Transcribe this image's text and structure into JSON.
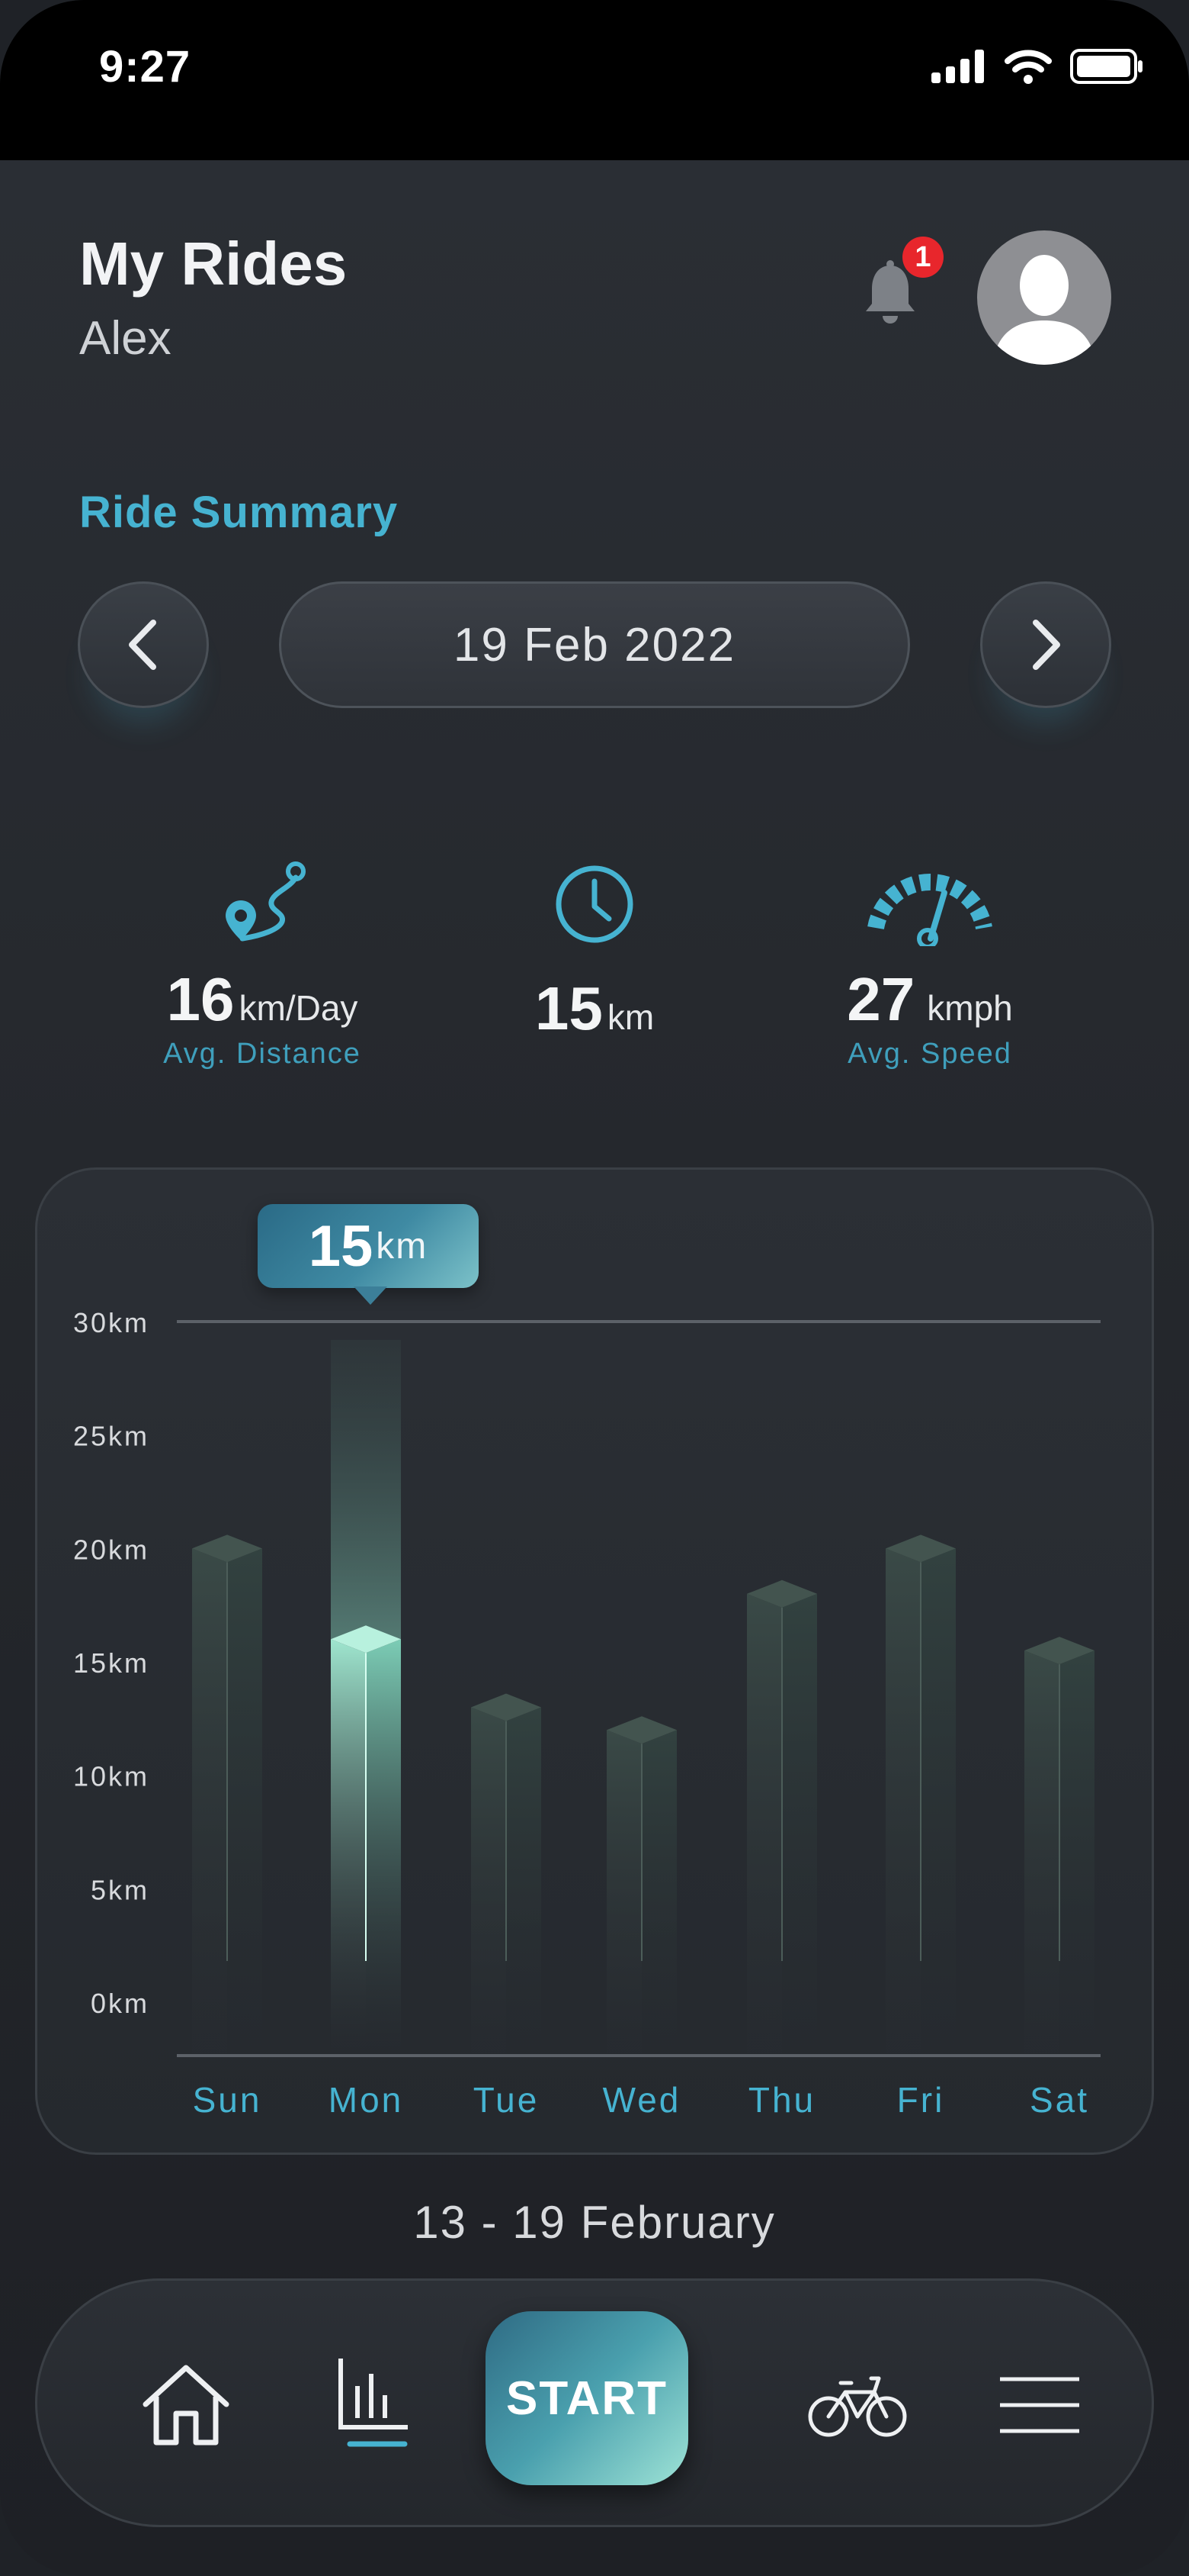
{
  "status_bar": {
    "time": "9:27"
  },
  "header": {
    "title": "My Rides",
    "user": "Alex",
    "notification_count": "1"
  },
  "summary": {
    "label": "Ride Summary",
    "date": "19 Feb 2022"
  },
  "stats": {
    "distance": {
      "value": "16",
      "unit": "km/Day",
      "caption": "Avg. Distance",
      "icon": "route-pin-icon"
    },
    "time": {
      "value": "15",
      "unit": "km",
      "icon": "clock-icon"
    },
    "speed": {
      "value": "27",
      "unit": "kmph",
      "caption": "Avg. Speed",
      "icon": "speedometer-icon"
    }
  },
  "tooltip": {
    "value": "15",
    "unit": "km"
  },
  "chart_data": {
    "type": "bar",
    "categories": [
      "Sun",
      "Mon",
      "Tue",
      "Wed",
      "Thu",
      "Fri",
      "Sat"
    ],
    "values": [
      20,
      16,
      13,
      12,
      18,
      20,
      15.5
    ],
    "highlighted": "Mon",
    "y_ticks": [
      "0km",
      "5km",
      "10km",
      "15km",
      "20km",
      "25km",
      "30km"
    ],
    "ylim": [
      0,
      30
    ],
    "colors": {
      "bar": "#3a4a47",
      "highlight": "#9fe6cf",
      "axis_label": "#46b3d1"
    }
  },
  "week_range": "13 - 19 February",
  "nav": {
    "start_label": "START",
    "items": [
      "home-icon",
      "stats-icon",
      "bike-icon",
      "menu-icon"
    ],
    "accent": "#46b3d1"
  }
}
